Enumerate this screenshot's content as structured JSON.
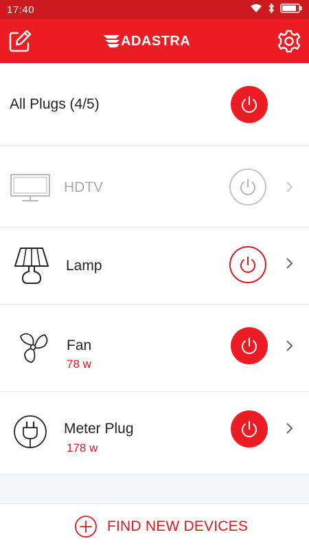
{
  "status_bar": {
    "time": "17:40",
    "icons": [
      "wifi-icon",
      "bluetooth-icon",
      "battery-icon"
    ]
  },
  "header": {
    "brand": "ADASTRA",
    "left_icon": "edit-icon",
    "right_icon": "gear-icon"
  },
  "colors": {
    "accent": "#ed1c24",
    "status_bar": "#cc1a1f",
    "off_gray": "#b5b5b5",
    "watts_text": "#e3151b"
  },
  "all_plugs": {
    "label": "All Plugs (4/5)",
    "state": "on"
  },
  "devices": [
    {
      "name": "HDTV",
      "icon": "tv-icon",
      "state": "off",
      "watts": ""
    },
    {
      "name": "Lamp",
      "icon": "lamp-icon",
      "state": "on-outline",
      "watts": ""
    },
    {
      "name": "Fan",
      "icon": "fan-icon",
      "state": "on",
      "watts": "78 w"
    },
    {
      "name": "Meter Plug",
      "icon": "plug-icon",
      "state": "on",
      "watts": "178 w"
    }
  ],
  "footer": {
    "find_label": "FIND NEW DEVICES",
    "icon": "plus-circle-icon"
  }
}
